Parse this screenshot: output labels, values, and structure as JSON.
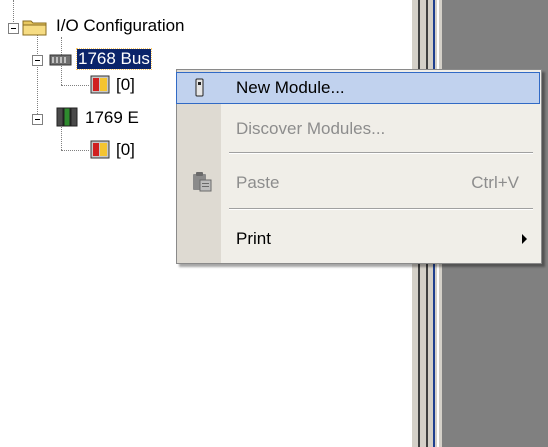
{
  "tree": {
    "io_configuration": "I/O Configuration",
    "bus_1768": "1768 Bus",
    "slot_1768": "[0]",
    "bus_1769": "1769 E",
    "slot_1769": "[0]"
  },
  "context_menu": {
    "new_module": "New Module...",
    "discover_modules": "Discover Modules...",
    "paste": "Paste",
    "paste_shortcut": "Ctrl+V",
    "print": "Print"
  },
  "colors": {
    "selection": "#0a246a",
    "menu_highlight": "#c1d2ee",
    "disabled_text": "#8d8d8d"
  }
}
